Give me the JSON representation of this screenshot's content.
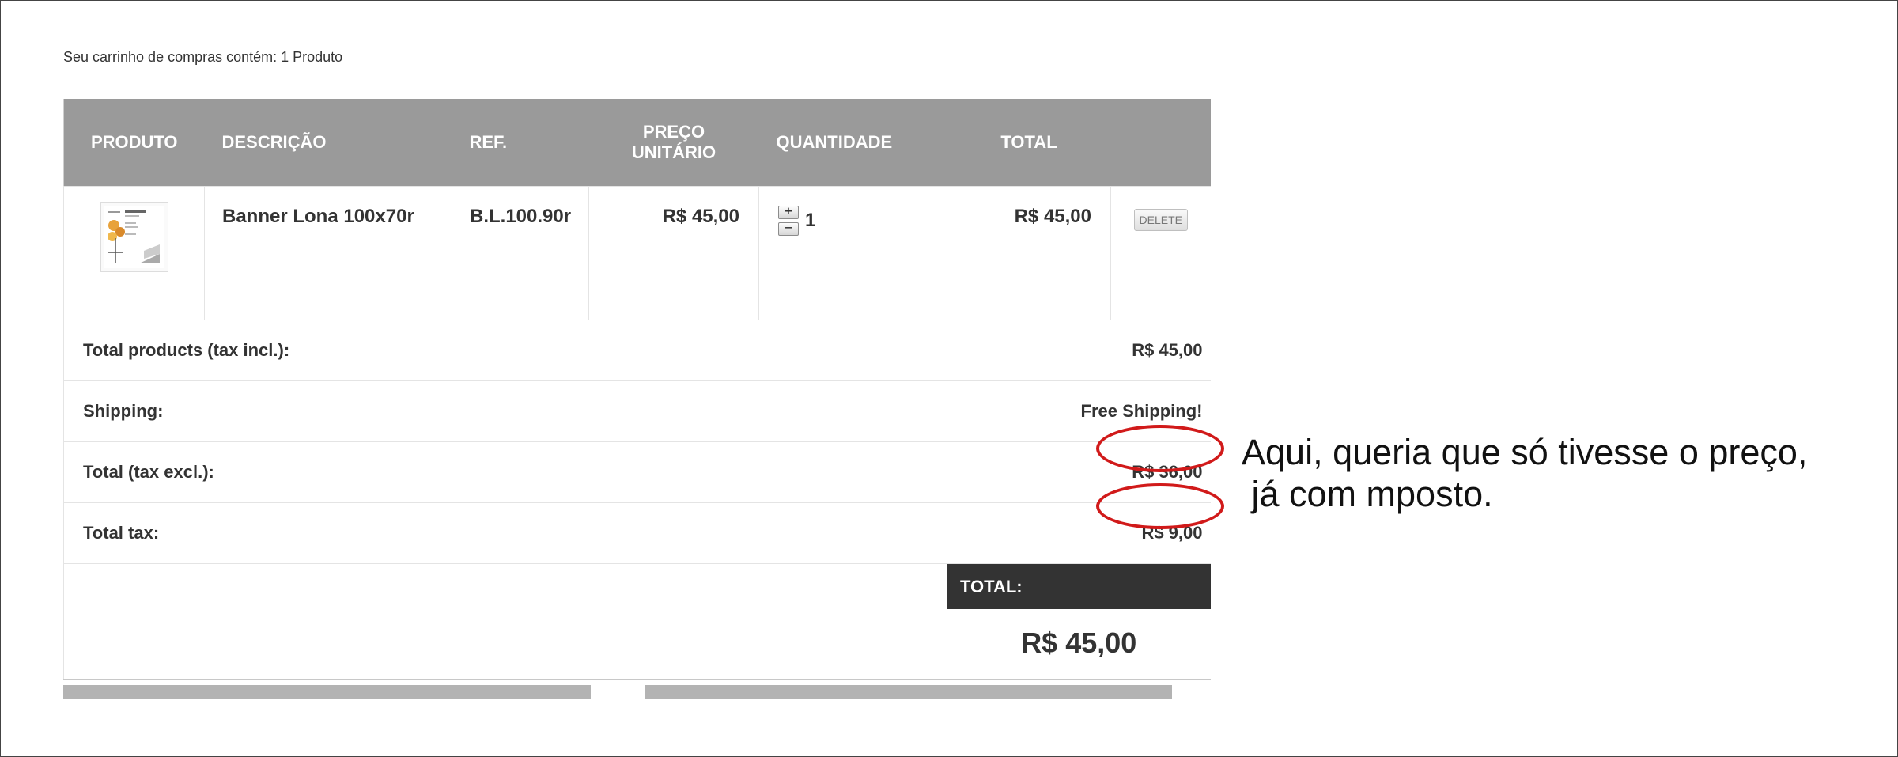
{
  "cart_summary": "Seu carrinho de compras contém: 1 Produto",
  "table": {
    "headers": {
      "product": "PRODUTO",
      "description": "DESCRIÇÃO",
      "ref": "REF.",
      "unit_price_line1": "PREÇO",
      "unit_price_line2": "UNITÁRIO",
      "quantity": "QUANTIDADE",
      "total": "TOTAL"
    },
    "row": {
      "description": "Banner Lona 100x70r",
      "ref": "B.L.100.90r",
      "unit_price": "R$ 45,00",
      "quantity": "1",
      "qty_plus": "+",
      "qty_minus": "−",
      "total": "R$ 45,00",
      "delete_label": "DELETE"
    },
    "summary": [
      {
        "label": "Total products (tax incl.):",
        "value": "R$ 45,00"
      },
      {
        "label": "Shipping:",
        "value": "Free Shipping!"
      },
      {
        "label": "Total (tax excl.):",
        "value": "R$ 36,00"
      },
      {
        "label": "Total tax:",
        "value": "R$ 9,00"
      }
    ],
    "grand_total_label": "TOTAL:",
    "grand_total_value": "R$ 45,00"
  },
  "annotation": {
    "line1": "Aqui, queria que só tivesse o preço,",
    "line2": " já com mposto.",
    "color": "#d11a1a"
  }
}
